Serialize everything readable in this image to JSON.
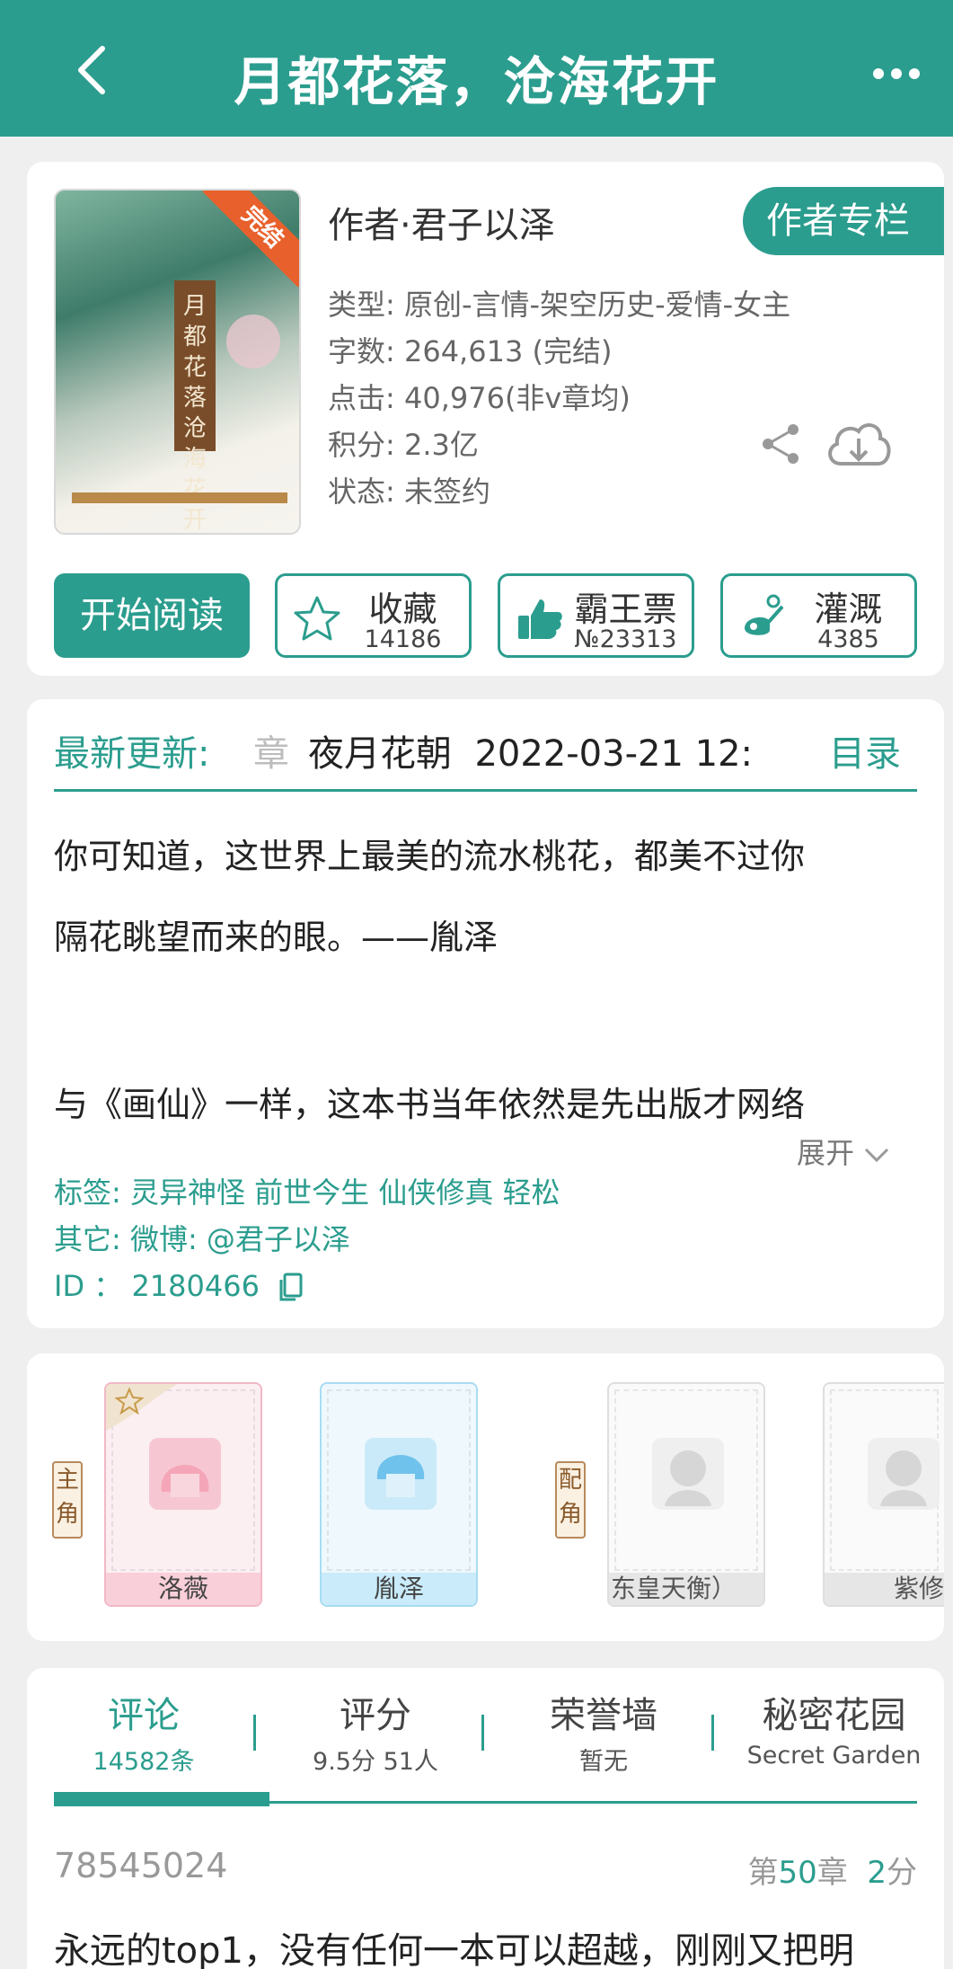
{
  "header": {
    "title": "月都花落，沧海花开",
    "back_icon": "chevron-left-icon",
    "more_icon": "more-dots-icon"
  },
  "book": {
    "status_badge": "完结",
    "cover_title": "月都花落 沧海花开",
    "author": "作者·君子以泽",
    "author_column_label": "作者专栏",
    "info": [
      {
        "label": "类型:",
        "value": "原创-言情-架空历史-爱情-女主"
      },
      {
        "label": "字数:",
        "value": "264,613 (完结)"
      },
      {
        "label": "点击:",
        "value": "40,976(非v章均)"
      },
      {
        "label": "积分:",
        "value": "2.3亿"
      },
      {
        "label": "状态:",
        "value": "未签约"
      }
    ],
    "read_label": "开始阅读",
    "stats": [
      {
        "label": "收藏",
        "value": "14186",
        "icon": "star-icon"
      },
      {
        "label": "霸王票",
        "value": "№23313",
        "icon": "thumbs-up-icon"
      },
      {
        "label": "灌溉",
        "value": "4385",
        "icon": "watering-can-icon"
      }
    ],
    "colors": {
      "accent": "#2b9d8e",
      "badge": "#e8602b"
    }
  },
  "update": {
    "label": "最新更新:",
    "chapter_prefix": "章",
    "chapter": "夜月花朝",
    "datetime": "2022-03-21 12:",
    "catalog_label": "目录"
  },
  "description": {
    "lines": [
      "你可知道，这世界上最美的流水桃花，都美不过你",
      "隔花眺望而来的眼。——胤泽",
      "与《画仙》一样，这本书当年依然是先出版才网络"
    ],
    "expand_label": "展开"
  },
  "meta": {
    "tags_label": "标签:",
    "tags": "灵异神怪 前世今生 仙侠修真 轻松",
    "other_label": "其它:",
    "other": "微博: @君子以泽",
    "id_label": "ID ：",
    "id": "2180466"
  },
  "roles": {
    "main_label": "主角",
    "side_label": "配角",
    "characters": [
      {
        "name": "洛薇"
      },
      {
        "name": "胤泽"
      },
      {
        "name": "东皇天衡）"
      },
      {
        "name": "紫修"
      }
    ]
  },
  "tabs": [
    {
      "title": "评论",
      "sub": "14582条"
    },
    {
      "title": "评分",
      "sub": "9.5分 51人"
    },
    {
      "title": "荣誉墙",
      "sub": "暂无"
    },
    {
      "title": "秘密花园",
      "sub": "Secret Garden"
    }
  ],
  "comment": {
    "user": "78545024",
    "chapter_prefix": "第",
    "chapter_num": "50",
    "chapter_suffix": "章",
    "score_num": "2",
    "score_suffix": "分",
    "text": "永远的top1，没有任何一本可以超越，刚刚又把明"
  }
}
